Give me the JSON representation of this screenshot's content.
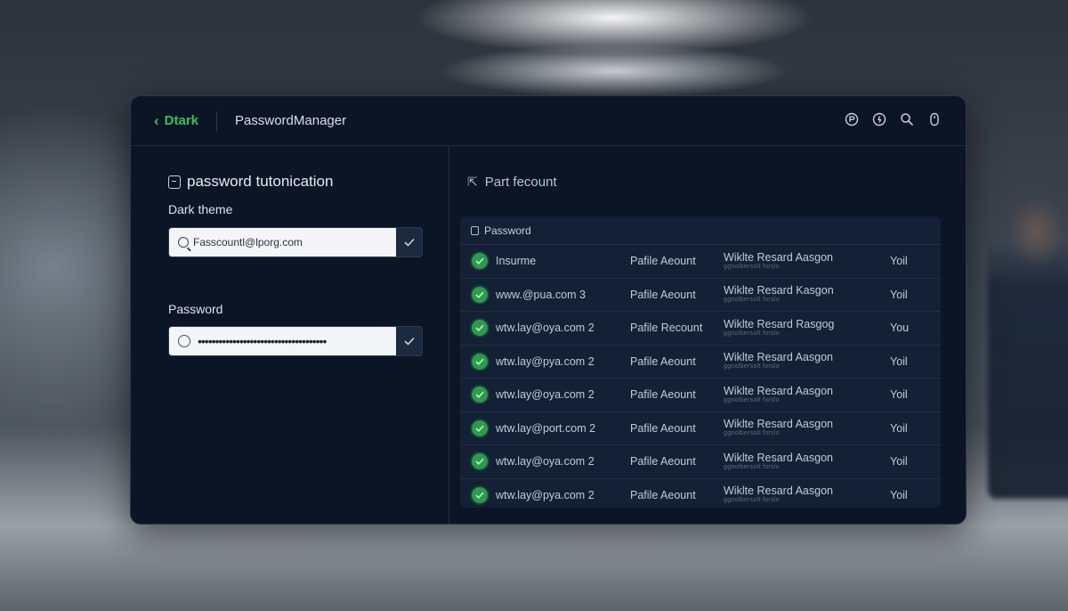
{
  "titlebar": {
    "back_label": "Dtark",
    "app_title": "PasswordManager",
    "icons": [
      "settings-icon",
      "info-icon",
      "search-icon",
      "mouse-icon"
    ]
  },
  "left": {
    "heading": "password tutonication",
    "email_label": "Dark theme",
    "email_value": "Fasscountl@lporg.com",
    "password_label": "Password",
    "password_value": "•••••••••••••••••••••••••••••••••••••"
  },
  "right": {
    "heading": "Part fecount",
    "table_header": "Password",
    "rows": [
      {
        "site": "Insurme",
        "profile": "Pafile Aeount",
        "note": "Wiklte Resard Aasgon",
        "note_sub": "ggnolbersolt forslo",
        "value": "Yoil"
      },
      {
        "site": "www.@pua.com 3",
        "profile": "Pafile Aeount",
        "note": "Wiklte Resard Kasgon",
        "note_sub": "ggnolbersolt forslo",
        "value": "Yoil"
      },
      {
        "site": "wtw.lay@oya.com 2",
        "profile": "Pafile Recount",
        "note": "Wiklte Resard Rasgog",
        "note_sub": "ggnolbersolt forslo",
        "value": "You"
      },
      {
        "site": "wtw.lay@pya.com 2",
        "profile": "Pafile Aeount",
        "note": "Wiklte Resard Aasgon",
        "note_sub": "ggnolbersolt forslo",
        "value": "Yoil"
      },
      {
        "site": "wtw.lay@oya.com 2",
        "profile": "Pafile Aeount",
        "note": "Wiklte Resard Aasgon",
        "note_sub": "ggnolbersolt forslo",
        "value": "Yoil"
      },
      {
        "site": "wtw.lay@port.com 2",
        "profile": "Pafile Aeount",
        "note": "Wiklte Resard Aasgon",
        "note_sub": "ggnolbersolt forslo",
        "value": "Yoil"
      },
      {
        "site": "wtw.lay@oya.com 2",
        "profile": "Pafile Aeount",
        "note": "Wiklte Resard Aasgon",
        "note_sub": "ggnolbersolt forslo",
        "value": "Yoil"
      },
      {
        "site": "wtw.lay@pya.com 2",
        "profile": "Pafile Aeount",
        "note": "Wiklte Resard Aasgon",
        "note_sub": "ggnolbersolt forslo",
        "value": "Yoil"
      }
    ]
  },
  "colors": {
    "accent": "#3fbf5a",
    "window_bg": "#0b1526",
    "table_bg": "#132036",
    "status_ok": "#2e9a4d"
  }
}
